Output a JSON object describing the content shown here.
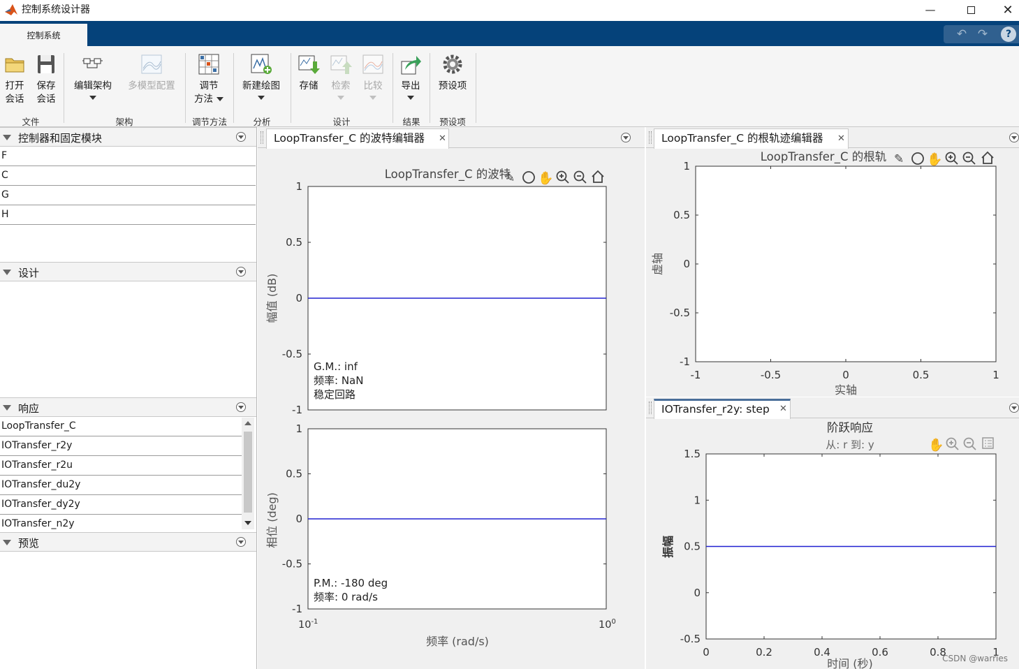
{
  "window": {
    "title": "控制系统设计器"
  },
  "ribbon": {
    "tab": "控制系统",
    "buttons": {
      "open": [
        "打开",
        "会话"
      ],
      "save": [
        "保存",
        "会话"
      ],
      "edit_arch": "编辑架构",
      "multimodel": "多模型配置",
      "tune": [
        "调节",
        "方法"
      ],
      "new_plot": "新建绘图",
      "store": "存储",
      "retrieve": "检索",
      "compare": "比较",
      "export": "导出",
      "preferences": "预设项"
    },
    "groups": [
      "文件",
      "架构",
      "调节方法",
      "分析",
      "设计",
      "结果",
      "预设项"
    ]
  },
  "left": {
    "controllers": {
      "title": "控制器和固定模块",
      "items": [
        "F",
        "C",
        "G",
        "H"
      ]
    },
    "designs": {
      "title": "设计"
    },
    "responses": {
      "title": "响应",
      "items": [
        "LoopTransfer_C",
        "IOTransfer_r2y",
        "IOTransfer_r2u",
        "IOTransfer_du2y",
        "IOTransfer_dy2y",
        "IOTransfer_n2y"
      ]
    },
    "preview": {
      "title": "预览"
    }
  },
  "bode": {
    "tab": "LoopTransfer_C 的波特编辑器",
    "title": "LoopTransfer_C 的波特",
    "mag": {
      "ylabel": "幅值 (dB)",
      "yticks": [
        "1",
        "0.5",
        "0",
        "-0.5",
        "-1"
      ],
      "annotation": [
        "G.M.: inf",
        "频率: NaN",
        "稳定回路"
      ]
    },
    "phase": {
      "ylabel": "相位 (deg)",
      "yticks": [
        "1",
        "0.5",
        "0",
        "-0.5",
        "-1"
      ],
      "annotation": [
        "P.M.: -180 deg",
        "频率: 0 rad/s"
      ]
    },
    "xlabel": "频率 (rad/s)",
    "xticks": [
      {
        "base": "10",
        "exp": "-1"
      },
      {
        "base": "10",
        "exp": "0"
      }
    ]
  },
  "rlocus": {
    "tab": "LoopTransfer_C 的根轨迹编辑器",
    "title": "LoopTransfer_C 的根轨",
    "ylabel": "虚轴",
    "xlabel": "实轴",
    "yticks": [
      "1",
      "0.5",
      "0",
      "-0.5",
      "-1"
    ],
    "xticks": [
      "-1",
      "-0.5",
      "0",
      "0.5",
      "1"
    ]
  },
  "step": {
    "tab": "IOTransfer_r2y: step",
    "title": "阶跃响应",
    "subtitle": "从: r  到: y",
    "ylabel": "振幅",
    "xlabel": "时间 (秒)",
    "yticks": [
      "1.5",
      "1",
      "0.5",
      "0",
      "-0.5"
    ],
    "xticks": [
      "0",
      "0.2",
      "0.4",
      "0.6",
      "0.8",
      "1"
    ]
  },
  "watermark": "CSDN @warries",
  "chart_data": [
    {
      "type": "line",
      "title": "LoopTransfer_C 的波特",
      "xlabel": "频率 (rad/s)",
      "ylabel": "幅值 (dB)",
      "xscale": "log",
      "xlim": [
        0.1,
        1
      ],
      "ylim": [
        -1,
        1
      ],
      "series": [
        {
          "x": [
            0.1,
            1
          ],
          "y": [
            0,
            0
          ]
        }
      ],
      "color": "#2020d0"
    },
    {
      "type": "line",
      "xlabel": "频率 (rad/s)",
      "ylabel": "相位 (deg)",
      "xscale": "log",
      "xlim": [
        0.1,
        1
      ],
      "ylim": [
        -1,
        1
      ],
      "series": [
        {
          "x": [
            0.1,
            1
          ],
          "y": [
            0,
            0
          ]
        }
      ],
      "color": "#2020d0"
    },
    {
      "type": "scatter",
      "title": "LoopTransfer_C 的根轨",
      "xlabel": "实轴",
      "ylabel": "虚轴",
      "xlim": [
        -1,
        1
      ],
      "ylim": [
        -1,
        1
      ],
      "series": []
    },
    {
      "type": "line",
      "title": "阶跃响应",
      "xlabel": "时间 (秒)",
      "ylabel": "振幅",
      "xlim": [
        0,
        1
      ],
      "ylim": [
        -0.5,
        1.5
      ],
      "series": [
        {
          "x": [
            0,
            1
          ],
          "y": [
            0.5,
            0.5
          ]
        }
      ],
      "color": "#2020d0"
    }
  ]
}
